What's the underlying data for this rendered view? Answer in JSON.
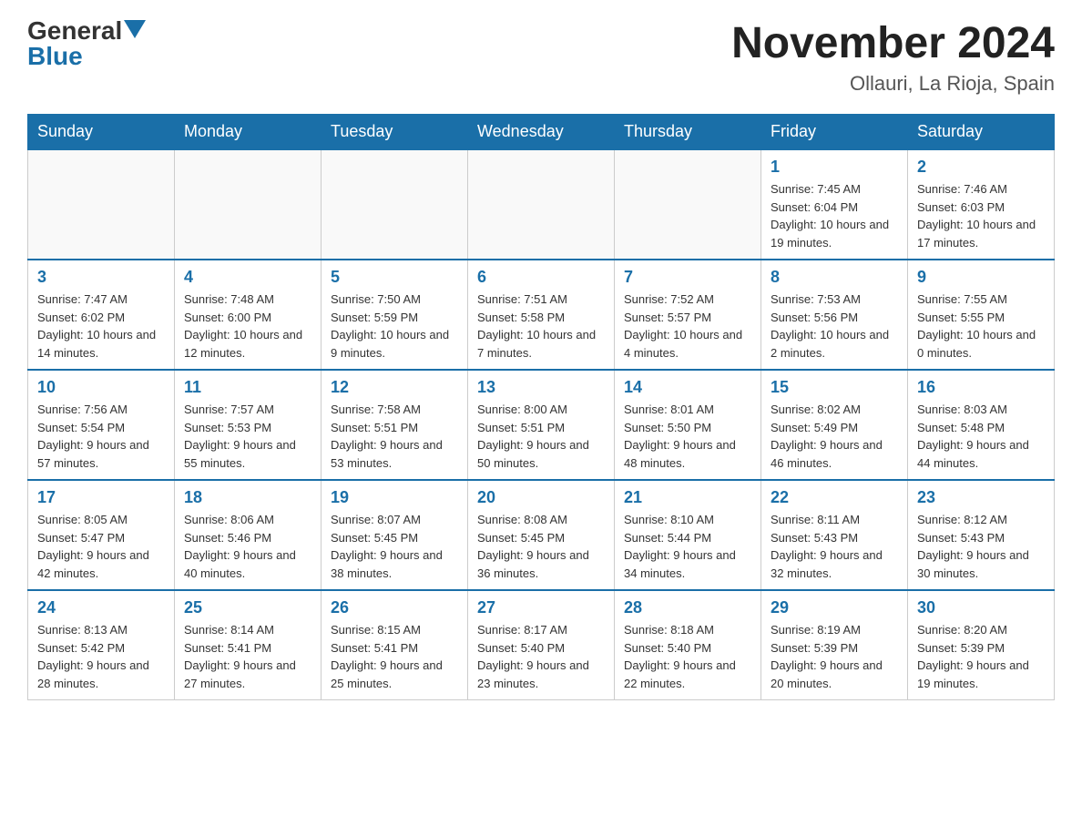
{
  "header": {
    "logo_general": "General",
    "logo_blue": "Blue",
    "month_title": "November 2024",
    "location": "Ollauri, La Rioja, Spain"
  },
  "days_of_week": [
    "Sunday",
    "Monday",
    "Tuesday",
    "Wednesday",
    "Thursday",
    "Friday",
    "Saturday"
  ],
  "weeks": [
    [
      {
        "day": "",
        "info": ""
      },
      {
        "day": "",
        "info": ""
      },
      {
        "day": "",
        "info": ""
      },
      {
        "day": "",
        "info": ""
      },
      {
        "day": "",
        "info": ""
      },
      {
        "day": "1",
        "info": "Sunrise: 7:45 AM\nSunset: 6:04 PM\nDaylight: 10 hours and 19 minutes."
      },
      {
        "day": "2",
        "info": "Sunrise: 7:46 AM\nSunset: 6:03 PM\nDaylight: 10 hours and 17 minutes."
      }
    ],
    [
      {
        "day": "3",
        "info": "Sunrise: 7:47 AM\nSunset: 6:02 PM\nDaylight: 10 hours and 14 minutes."
      },
      {
        "day": "4",
        "info": "Sunrise: 7:48 AM\nSunset: 6:00 PM\nDaylight: 10 hours and 12 minutes."
      },
      {
        "day": "5",
        "info": "Sunrise: 7:50 AM\nSunset: 5:59 PM\nDaylight: 10 hours and 9 minutes."
      },
      {
        "day": "6",
        "info": "Sunrise: 7:51 AM\nSunset: 5:58 PM\nDaylight: 10 hours and 7 minutes."
      },
      {
        "day": "7",
        "info": "Sunrise: 7:52 AM\nSunset: 5:57 PM\nDaylight: 10 hours and 4 minutes."
      },
      {
        "day": "8",
        "info": "Sunrise: 7:53 AM\nSunset: 5:56 PM\nDaylight: 10 hours and 2 minutes."
      },
      {
        "day": "9",
        "info": "Sunrise: 7:55 AM\nSunset: 5:55 PM\nDaylight: 10 hours and 0 minutes."
      }
    ],
    [
      {
        "day": "10",
        "info": "Sunrise: 7:56 AM\nSunset: 5:54 PM\nDaylight: 9 hours and 57 minutes."
      },
      {
        "day": "11",
        "info": "Sunrise: 7:57 AM\nSunset: 5:53 PM\nDaylight: 9 hours and 55 minutes."
      },
      {
        "day": "12",
        "info": "Sunrise: 7:58 AM\nSunset: 5:51 PM\nDaylight: 9 hours and 53 minutes."
      },
      {
        "day": "13",
        "info": "Sunrise: 8:00 AM\nSunset: 5:51 PM\nDaylight: 9 hours and 50 minutes."
      },
      {
        "day": "14",
        "info": "Sunrise: 8:01 AM\nSunset: 5:50 PM\nDaylight: 9 hours and 48 minutes."
      },
      {
        "day": "15",
        "info": "Sunrise: 8:02 AM\nSunset: 5:49 PM\nDaylight: 9 hours and 46 minutes."
      },
      {
        "day": "16",
        "info": "Sunrise: 8:03 AM\nSunset: 5:48 PM\nDaylight: 9 hours and 44 minutes."
      }
    ],
    [
      {
        "day": "17",
        "info": "Sunrise: 8:05 AM\nSunset: 5:47 PM\nDaylight: 9 hours and 42 minutes."
      },
      {
        "day": "18",
        "info": "Sunrise: 8:06 AM\nSunset: 5:46 PM\nDaylight: 9 hours and 40 minutes."
      },
      {
        "day": "19",
        "info": "Sunrise: 8:07 AM\nSunset: 5:45 PM\nDaylight: 9 hours and 38 minutes."
      },
      {
        "day": "20",
        "info": "Sunrise: 8:08 AM\nSunset: 5:45 PM\nDaylight: 9 hours and 36 minutes."
      },
      {
        "day": "21",
        "info": "Sunrise: 8:10 AM\nSunset: 5:44 PM\nDaylight: 9 hours and 34 minutes."
      },
      {
        "day": "22",
        "info": "Sunrise: 8:11 AM\nSunset: 5:43 PM\nDaylight: 9 hours and 32 minutes."
      },
      {
        "day": "23",
        "info": "Sunrise: 8:12 AM\nSunset: 5:43 PM\nDaylight: 9 hours and 30 minutes."
      }
    ],
    [
      {
        "day": "24",
        "info": "Sunrise: 8:13 AM\nSunset: 5:42 PM\nDaylight: 9 hours and 28 minutes."
      },
      {
        "day": "25",
        "info": "Sunrise: 8:14 AM\nSunset: 5:41 PM\nDaylight: 9 hours and 27 minutes."
      },
      {
        "day": "26",
        "info": "Sunrise: 8:15 AM\nSunset: 5:41 PM\nDaylight: 9 hours and 25 minutes."
      },
      {
        "day": "27",
        "info": "Sunrise: 8:17 AM\nSunset: 5:40 PM\nDaylight: 9 hours and 23 minutes."
      },
      {
        "day": "28",
        "info": "Sunrise: 8:18 AM\nSunset: 5:40 PM\nDaylight: 9 hours and 22 minutes."
      },
      {
        "day": "29",
        "info": "Sunrise: 8:19 AM\nSunset: 5:39 PM\nDaylight: 9 hours and 20 minutes."
      },
      {
        "day": "30",
        "info": "Sunrise: 8:20 AM\nSunset: 5:39 PM\nDaylight: 9 hours and 19 minutes."
      }
    ]
  ]
}
